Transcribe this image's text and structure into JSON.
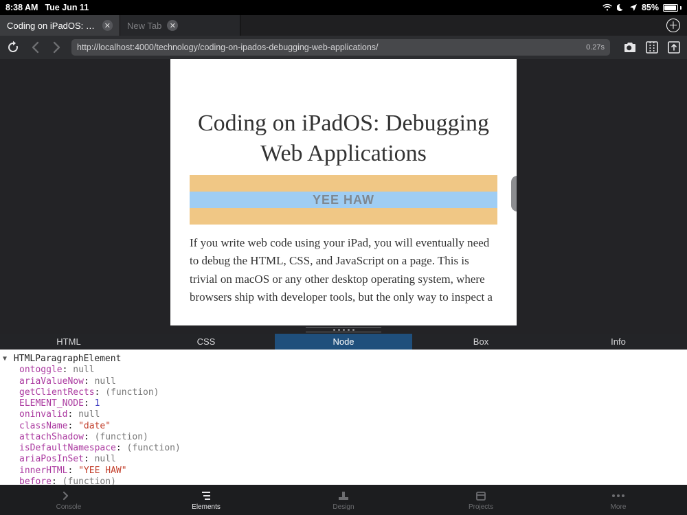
{
  "status": {
    "time": "8:38 AM",
    "date": "Tue Jun 11",
    "battery_pct": "85%"
  },
  "tabs": {
    "items": [
      {
        "title": "Coding on iPadOS: D…",
        "active": true
      },
      {
        "title": "New Tab",
        "active": false
      }
    ]
  },
  "toolbar": {
    "url": "http://localhost:4000/technology/coding-on-ipados-debugging-web-applications/",
    "load_time": "0.27s"
  },
  "page": {
    "title": "Coding on iPadOS: Debugging Web Applications",
    "highlight_text": "YEE HAW",
    "body": "If you write web code using your iPad, you will eventually need to debug the HTML, CSS, and JavaScript on a page. This is trivial on macOS or any other desktop operating system, where browsers ship with developer tools, but the only way to inspect a"
  },
  "inspector": {
    "tabs": [
      "HTML",
      "CSS",
      "Node",
      "Box",
      "Info"
    ],
    "selected_tab": "Node",
    "node_name": "HTMLParagraphElement",
    "props": [
      {
        "key": "ontoggle",
        "kind": "null",
        "value": "null"
      },
      {
        "key": "ariaValueNow",
        "kind": "null",
        "value": "null"
      },
      {
        "key": "getClientRects",
        "kind": "fn",
        "value": "(function)"
      },
      {
        "key": "ELEMENT_NODE",
        "kind": "num",
        "value": "1"
      },
      {
        "key": "oninvalid",
        "kind": "null",
        "value": "null"
      },
      {
        "key": "className",
        "kind": "str",
        "value": "\"date\""
      },
      {
        "key": "attachShadow",
        "kind": "fn",
        "value": "(function)"
      },
      {
        "key": "isDefaultNamespace",
        "kind": "fn",
        "value": "(function)"
      },
      {
        "key": "ariaPosInSet",
        "kind": "null",
        "value": "null"
      },
      {
        "key": "innerHTML",
        "kind": "str",
        "value": "\"YEE HAW\""
      },
      {
        "key": "before",
        "kind": "fn",
        "value": "(function)"
      }
    ]
  },
  "bottom_nav": {
    "items": [
      {
        "label": "Console",
        "icon": "console"
      },
      {
        "label": "Elements",
        "icon": "elements",
        "active": true
      },
      {
        "label": "Design",
        "icon": "design"
      },
      {
        "label": "Projects",
        "icon": "projects"
      },
      {
        "label": "More",
        "icon": "more"
      }
    ]
  }
}
